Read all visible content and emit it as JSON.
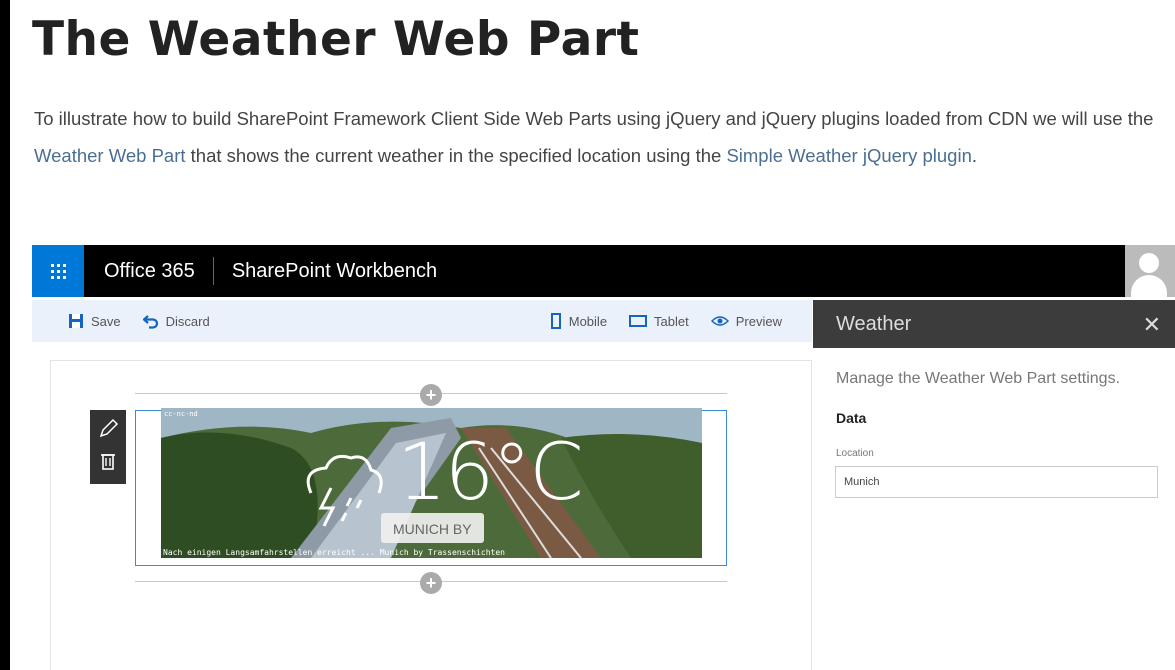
{
  "article": {
    "title": "The Weather Web Part",
    "para_part1": "To illustrate how to build SharePoint Framework Client Side Web Parts using jQuery and jQuery plugins loaded from CDN we will use the ",
    "link1": "Weather Web Part",
    "para_part2": " that shows the current weather in the specified location using the ",
    "link2": "Simple Weather jQuery plugin",
    "para_part3": "."
  },
  "suitebar": {
    "brand": "Office 365",
    "app": "SharePoint Workbench",
    "accent_color": "#0078d7"
  },
  "commandbar": {
    "save": "Save",
    "discard": "Discard",
    "mobile": "Mobile",
    "tablet": "Tablet",
    "preview": "Preview"
  },
  "webpart": {
    "temperature": "16°C",
    "location_label": "MUNICH BY",
    "image_caption_top": "cc-nc-nd",
    "image_caption": "Nach einigen Langsamfahrstellen erreicht ... Munich by Trassenschichten"
  },
  "pane": {
    "title": "Weather",
    "description": "Manage the Weather Web Part settings.",
    "group": "Data",
    "location_label": "Location",
    "location_value": "Munich"
  }
}
